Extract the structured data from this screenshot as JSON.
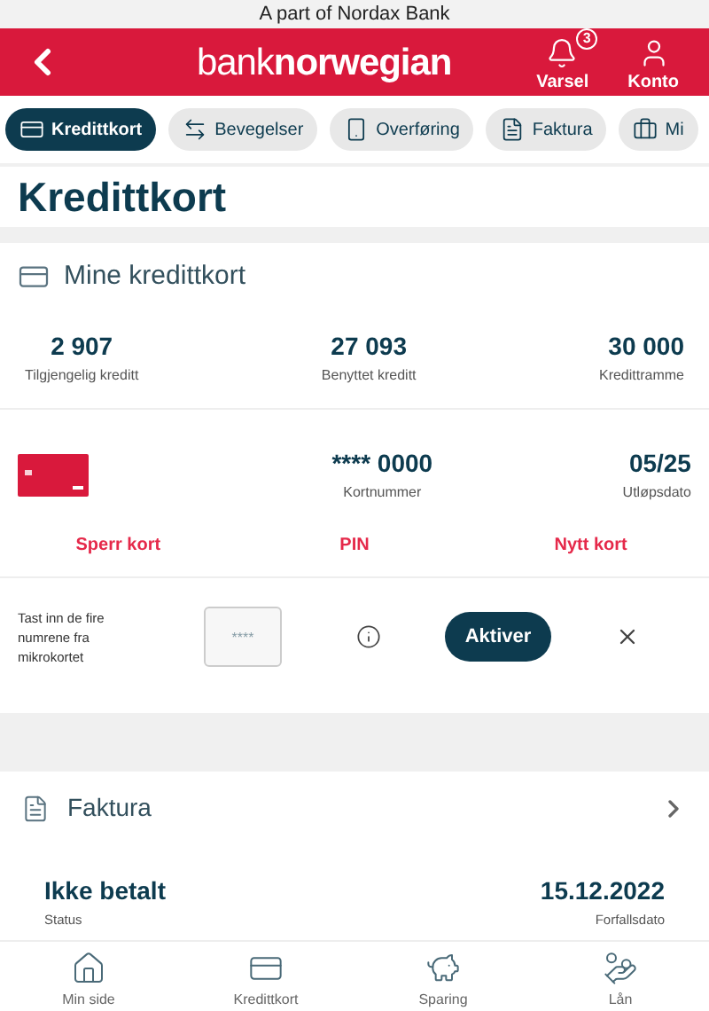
{
  "top_banner": "A part of Nordax Bank",
  "header": {
    "logo_light": "bank",
    "logo_bold": "norwegian",
    "actions": [
      {
        "label": "Varsel",
        "badge": "3"
      },
      {
        "label": "Konto"
      }
    ]
  },
  "tabs": [
    {
      "label": "Kredittkort",
      "selected": true
    },
    {
      "label": "Bevegelser",
      "selected": false
    },
    {
      "label": "Overføring",
      "selected": false
    },
    {
      "label": "Faktura",
      "selected": false
    },
    {
      "label": "Mi",
      "selected": false
    }
  ],
  "page_title": "Kredittkort",
  "cards_section": {
    "title": "Mine kredittkort",
    "stats": [
      {
        "value": "2 907",
        "label": "Tilgjengelig kreditt"
      },
      {
        "value": "27 093",
        "label": "Benyttet kreditt"
      },
      {
        "value": "30 000",
        "label": "Kredittramme"
      }
    ],
    "card": {
      "number": "**** 0000",
      "number_label": "Kortnummer",
      "expiry": "05/25",
      "expiry_label": "Utløpsdato"
    },
    "actions": [
      "Sperr kort",
      "PIN",
      "Nytt kort"
    ],
    "activation": {
      "instruction": "Tast inn de fire numrene fra mikrokortet",
      "placeholder": "****",
      "button": "Aktiver"
    }
  },
  "invoice": {
    "title": "Faktura",
    "status": {
      "value": "Ikke betalt",
      "label": "Status"
    },
    "due": {
      "value": "15.12.2022",
      "label": "Forfallsdato"
    }
  },
  "bottom_nav": [
    {
      "label": "Min side"
    },
    {
      "label": "Kredittkort"
    },
    {
      "label": "Sparing"
    },
    {
      "label": "Lån"
    }
  ]
}
